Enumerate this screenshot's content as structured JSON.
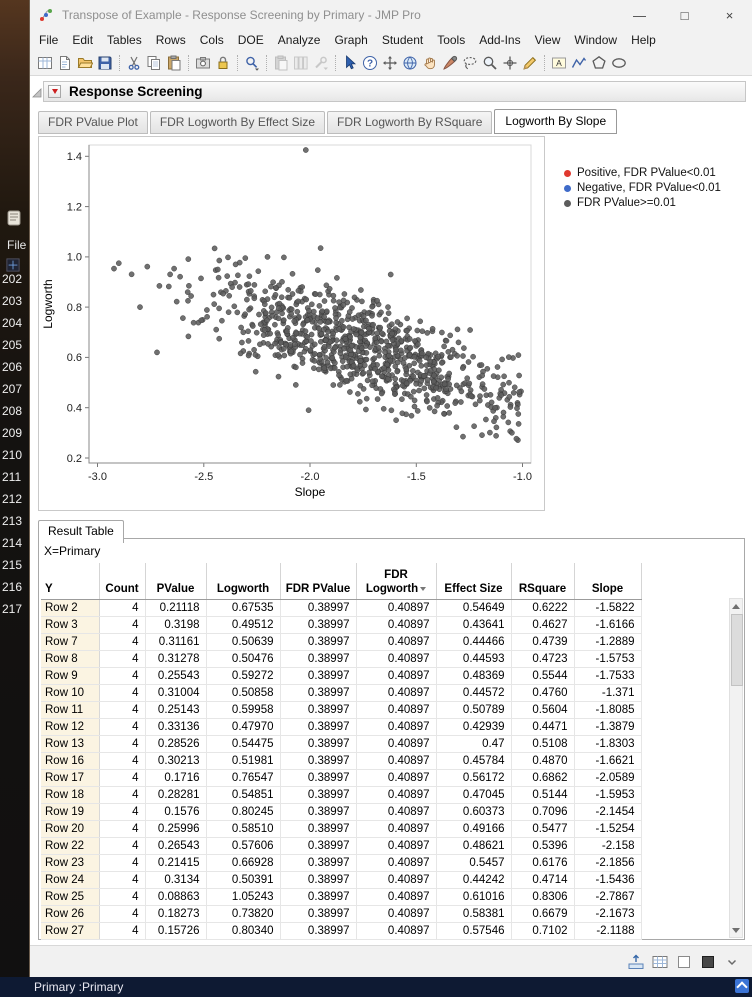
{
  "window": {
    "title": "Transpose of Example - Response Screening by Primary - JMP Pro",
    "controls": {
      "minimize": "—",
      "maximize": "□",
      "close": "×"
    }
  },
  "menu": {
    "items": [
      "File",
      "Edit",
      "Tables",
      "Rows",
      "Cols",
      "DOE",
      "Analyze",
      "Graph",
      "Student",
      "Tools",
      "Add-Ins",
      "View",
      "Window",
      "Help"
    ]
  },
  "toolbar": {
    "groups": [
      [
        "new-data-table-icon",
        "new-journal-icon",
        "open-icon",
        "save-icon"
      ],
      [
        "cut-icon",
        "copy-icon",
        "paste-icon"
      ],
      [
        "capture-icon",
        "lock-icon"
      ],
      [
        "search-icon"
      ],
      [
        "paste-special-icon",
        "column-info-icon",
        "tools-dropdown-icon"
      ],
      [
        "arrow-cursor-icon",
        "help-icon",
        "move-tool-icon",
        "globe-icon",
        "hand-tool-icon",
        "brush-tool-icon",
        "lasso-tool-icon",
        "zoom-tool-icon",
        "crosshair-tool-icon",
        "pencil-tool-icon"
      ],
      [
        "annotate-icon",
        "polyline-icon",
        "polygon-icon",
        "oval-icon"
      ]
    ],
    "disabled_groups": [
      4
    ]
  },
  "background_window": {
    "file_label": "File",
    "row_numbers": [
      "202",
      "203",
      "204",
      "205",
      "206",
      "207",
      "208",
      "209",
      "210",
      "211",
      "212",
      "213",
      "214",
      "215",
      "216",
      "217"
    ],
    "bottom_text": "Primary :Primary"
  },
  "report": {
    "title": "Response Screening",
    "tabs": [
      {
        "label": "FDR PValue Plot",
        "active": false
      },
      {
        "label": "FDR Logworth By Effect Size",
        "active": false
      },
      {
        "label": "FDR Logworth By RSquare",
        "active": false
      },
      {
        "label": "Logworth By Slope",
        "active": true
      }
    ]
  },
  "chart_data": {
    "type": "scatter",
    "title": "",
    "xlabel": "Slope",
    "ylabel": "Logworth",
    "xlim": [
      -3.0,
      -1.0
    ],
    "ylim": [
      0.2,
      1.4
    ],
    "xticks": [
      -3,
      -2.5,
      -2,
      -1.5,
      -1
    ],
    "yticks": [
      0.2,
      0.4,
      0.6,
      0.8,
      1,
      1.2,
      1.4
    ],
    "grid": false,
    "legend_position": "right",
    "series": [
      {
        "name": "Positive, FDR PValue<0.01",
        "color": "#e0392f",
        "points": []
      },
      {
        "name": "Negative, FDR PValue<0.01",
        "color": "#3f6bc9",
        "points": []
      },
      {
        "name": "FDR PValue>=0.01",
        "color": "#5c5c5c",
        "cloud": {
          "seed": 42,
          "count": 920,
          "x_mean": -1.76,
          "x_sd": 0.37,
          "x_min": -2.95,
          "x_max": -1.0,
          "trend_intercept": 0.16,
          "trend_slope": -0.27,
          "y_noise_sd": 0.095,
          "y_min": 0.27,
          "y_max": 1.12
        },
        "extra_points": [
          [
            -2.02,
            1.425
          ],
          [
            -2.9,
            0.975
          ],
          [
            -2.57,
            0.885
          ],
          [
            -2.2,
            1.0
          ],
          [
            -1.95,
            1.035
          ],
          [
            -2.35,
            0.97
          ],
          [
            -1.62,
            0.93
          ],
          [
            -1.28,
            0.285
          ],
          [
            -1.05,
            0.3
          ],
          [
            -1.02,
            0.375
          ],
          [
            -1.1,
            0.45
          ],
          [
            -2.72,
            0.62
          ],
          [
            -2.8,
            0.8
          ]
        ]
      }
    ]
  },
  "result_table": {
    "tab_label": "Result Table",
    "x_label": "X=Primary",
    "columns": [
      {
        "label": "Y"
      },
      {
        "label": "Count"
      },
      {
        "label": "PValue"
      },
      {
        "label": "Logworth"
      },
      {
        "label": "FDR PValue"
      },
      {
        "label": "FDR Logworth",
        "two_line": true,
        "sorted": true
      },
      {
        "label": "Effect Size"
      },
      {
        "label": "RSquare"
      },
      {
        "label": "Slope"
      }
    ],
    "rows": [
      [
        "Row 2",
        "4",
        "0.21118",
        "0.67535",
        "0.38997",
        "0.40897",
        "0.54649",
        "0.6222",
        "-1.5822"
      ],
      [
        "Row 3",
        "4",
        "0.3198",
        "0.49512",
        "0.38997",
        "0.40897",
        "0.43641",
        "0.4627",
        "-1.6166"
      ],
      [
        "Row 7",
        "4",
        "0.31161",
        "0.50639",
        "0.38997",
        "0.40897",
        "0.44466",
        "0.4739",
        "-1.2889"
      ],
      [
        "Row 8",
        "4",
        "0.31278",
        "0.50476",
        "0.38997",
        "0.40897",
        "0.44593",
        "0.4723",
        "-1.5753"
      ],
      [
        "Row 9",
        "4",
        "0.25543",
        "0.59272",
        "0.38997",
        "0.40897",
        "0.48369",
        "0.5544",
        "-1.7533"
      ],
      [
        "Row 10",
        "4",
        "0.31004",
        "0.50858",
        "0.38997",
        "0.40897",
        "0.44572",
        "0.4760",
        "-1.371"
      ],
      [
        "Row 11",
        "4",
        "0.25143",
        "0.59958",
        "0.38997",
        "0.40897",
        "0.50789",
        "0.5604",
        "-1.8085"
      ],
      [
        "Row 12",
        "4",
        "0.33136",
        "0.47970",
        "0.38997",
        "0.40897",
        "0.42939",
        "0.4471",
        "-1.3879"
      ],
      [
        "Row 13",
        "4",
        "0.28526",
        "0.54475",
        "0.38997",
        "0.40897",
        "0.47",
        "0.5108",
        "-1.8303"
      ],
      [
        "Row 16",
        "4",
        "0.30213",
        "0.51981",
        "0.38997",
        "0.40897",
        "0.45784",
        "0.4870",
        "-1.6621"
      ],
      [
        "Row 17",
        "4",
        "0.1716",
        "0.76547",
        "0.38997",
        "0.40897",
        "0.56172",
        "0.6862",
        "-2.0589"
      ],
      [
        "Row 18",
        "4",
        "0.28281",
        "0.54851",
        "0.38997",
        "0.40897",
        "0.47045",
        "0.5144",
        "-1.5953"
      ],
      [
        "Row 19",
        "4",
        "0.1576",
        "0.80245",
        "0.38997",
        "0.40897",
        "0.60373",
        "0.7096",
        "-2.1454"
      ],
      [
        "Row 20",
        "4",
        "0.25996",
        "0.58510",
        "0.38997",
        "0.40897",
        "0.49166",
        "0.5477",
        "-1.5254"
      ],
      [
        "Row 22",
        "4",
        "0.26543",
        "0.57606",
        "0.38997",
        "0.40897",
        "0.48621",
        "0.5396",
        "-2.158"
      ],
      [
        "Row 23",
        "4",
        "0.21415",
        "0.66928",
        "0.38997",
        "0.40897",
        "0.5457",
        "0.6176",
        "-2.1856"
      ],
      [
        "Row 24",
        "4",
        "0.3134",
        "0.50391",
        "0.38997",
        "0.40897",
        "0.44242",
        "0.4714",
        "-1.5436"
      ],
      [
        "Row 25",
        "4",
        "0.08863",
        "1.05243",
        "0.38997",
        "0.40897",
        "0.61016",
        "0.8306",
        "-2.7867"
      ],
      [
        "Row 26",
        "4",
        "0.18273",
        "0.73820",
        "0.38997",
        "0.40897",
        "0.58381",
        "0.6679",
        "-2.1673"
      ],
      [
        "Row 27",
        "4",
        "0.15726",
        "0.80340",
        "0.38997",
        "0.40897",
        "0.57546",
        "0.7102",
        "-2.1188"
      ]
    ]
  },
  "status_bar": {
    "icons": [
      "dock-report-icon",
      "data-grid-icon",
      "checkbox-icon",
      "color-well-icon",
      "chevron-down-icon"
    ]
  },
  "colors": {
    "red_triangle": "#cc1f1f",
    "legend_positive": "#e0392f",
    "legend_negative": "#3f6bc9",
    "legend_gray": "#5c5c5c",
    "row_label_bg": "#fbf4e2",
    "taskbar_bg": "#0e1a33"
  }
}
